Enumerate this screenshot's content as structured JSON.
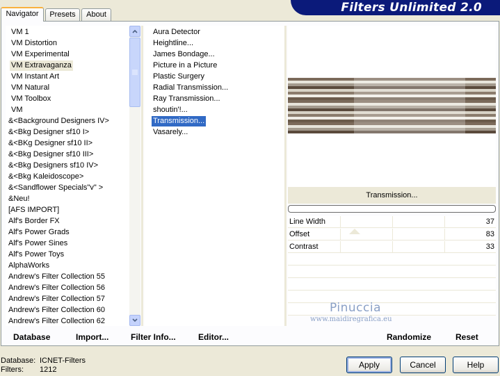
{
  "tabs": [
    {
      "label": "Navigator",
      "active": true
    },
    {
      "label": "Presets",
      "active": false
    },
    {
      "label": "About",
      "active": false
    }
  ],
  "banner": {
    "title": "Filters Unlimited 2.0",
    "color": "#0b1a7a"
  },
  "categories": {
    "selected": "VM Extravaganza",
    "items": [
      "VM 1",
      "VM Distortion",
      "VM Experimental",
      "VM Extravaganza",
      "VM Instant Art",
      "VM Natural",
      "VM Toolbox",
      "VM",
      "&<Background Designers IV>",
      "&<Bkg Designer sf10 I>",
      "&<BKg Designer sf10 II>",
      "&<Bkg Designer sf10 III>",
      "&<Bkg Designers sf10 IV>",
      "&<Bkg Kaleidoscope>",
      "&<Sandflower Specials\"v\" >",
      "&Neu!",
      "[AFS IMPORT]",
      "Alf's Border FX",
      "Alf's Power Grads",
      "Alf's Power Sines",
      "Alf's Power Toys",
      "AlphaWorks",
      "Andrew's Filter Collection 55",
      "Andrew's Filter Collection 56",
      "Andrew's Filter Collection 57",
      "Andrew's Filter Collection 60",
      "Andrew's Filter Collection 62"
    ]
  },
  "filters": {
    "selected": "Transmission...",
    "items": [
      " Aura Detector",
      "Heightline...",
      "James Bondage...",
      "Picture in a Picture",
      "Plastic Surgery",
      "Radial Transmission...",
      "Ray Transmission...",
      "shoutin'!...",
      "Transmission...",
      "Vasarely..."
    ]
  },
  "filter_panel": {
    "title": "Transmission...",
    "params": [
      {
        "name": "Line Width",
        "value": "37"
      },
      {
        "name": "Offset",
        "value": "83"
      },
      {
        "name": "Contrast",
        "value": "33"
      }
    ]
  },
  "watermark": {
    "name": "Pinuccia",
    "url": "www.maidiregrafica.eu"
  },
  "bottom_links": {
    "database": "Database",
    "import": "Import...",
    "filter_info": "Filter Info...",
    "editor": "Editor...",
    "randomize": "Randomize",
    "reset": "Reset"
  },
  "status": {
    "database_label": "Database:",
    "database_value": "ICNET-Filters",
    "filters_label": "Filters:",
    "filters_value": "1212"
  },
  "buttons": {
    "apply": "Apply",
    "cancel": "Cancel",
    "help": "Help"
  }
}
